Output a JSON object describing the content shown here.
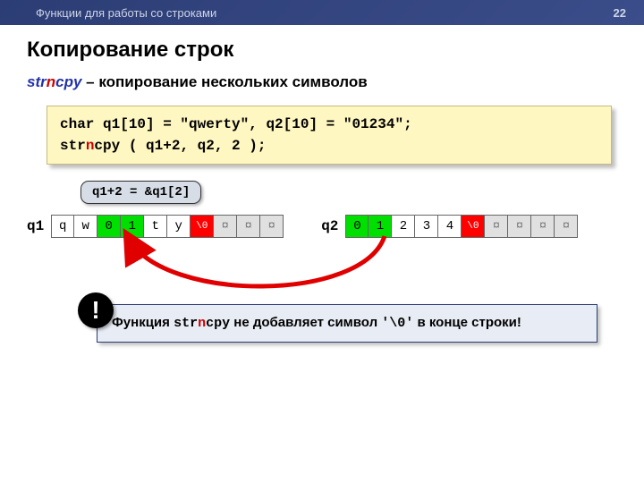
{
  "header": {
    "section": "Функции для работы со строками",
    "pagenum": "22"
  },
  "title": "Копирование строк",
  "subtitle": {
    "fn_pre": "str",
    "fn_mid": "n",
    "fn_post": "cpy",
    "desc": "  – копирование нескольких символов"
  },
  "code": {
    "line1": "char q1[10] = \"qwerty\", q2[10] = \"01234\";",
    "line2_pre": "str",
    "line2_mid": "n",
    "line2_post": "cpy ( q1+2, q2, 2 );"
  },
  "annot": "q1+2 = &q1[2]",
  "q1_label": "q1",
  "q2_label": "q2",
  "q1_cells": [
    "q",
    "w",
    "0",
    "1",
    "t",
    "y",
    "\\0",
    "¤",
    "¤",
    "¤"
  ],
  "q1_styles": [
    "",
    "",
    "hl",
    "hl",
    "",
    "",
    "z",
    "gar",
    "gar",
    "gar"
  ],
  "q2_cells": [
    "0",
    "1",
    "2",
    "3",
    "4",
    "\\0",
    "¤",
    "¤",
    "¤",
    "¤"
  ],
  "q2_styles": [
    "hl",
    "hl",
    "",
    "",
    "",
    "z",
    "gar",
    "gar",
    "gar",
    "gar"
  ],
  "note": {
    "badge": "!",
    "a": "Функция ",
    "b": "str",
    "c": "n",
    "d": "cpy",
    "e": " не добавляет символ ",
    "f": "'\\0'",
    "g": " в конце строки!"
  }
}
